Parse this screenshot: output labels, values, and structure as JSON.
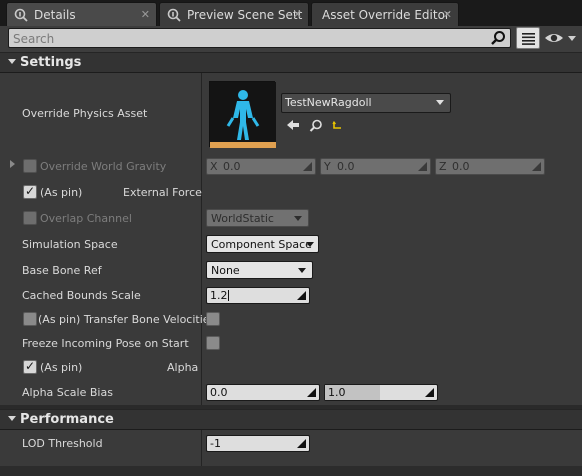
{
  "tabs": [
    {
      "label": "Details",
      "active": true
    },
    {
      "label": "Preview Scene Sett",
      "active": false
    },
    {
      "label": "Asset Override Editor",
      "active": false
    }
  ],
  "search": {
    "placeholder": "Search"
  },
  "categories": {
    "settings": "Settings",
    "performance": "Performance"
  },
  "settings": {
    "override_physics_asset": {
      "label": "Override Physics Asset",
      "value": "TestNewRagdoll"
    },
    "override_world_gravity": {
      "label": "Override World Gravity",
      "x_prefix": "X",
      "x": "0.0",
      "y_prefix": "Y",
      "y": "0.0",
      "z_prefix": "Z",
      "z": "0.0"
    },
    "external_force": {
      "pin_label": "(As pin)",
      "label": "External Force"
    },
    "overlap_channel": {
      "label": "Overlap Channel",
      "value": "WorldStatic"
    },
    "simulation_space": {
      "label": "Simulation Space",
      "value": "Component Space"
    },
    "base_bone_ref": {
      "label": "Base Bone Ref",
      "value": "None"
    },
    "cached_bounds_scale": {
      "label": "Cached Bounds Scale",
      "value": "1.2"
    },
    "transfer_bone_velocities": {
      "label": "(As pin) Transfer Bone Velocities"
    },
    "freeze_incoming_pose": {
      "label": "Freeze Incoming Pose on Start"
    },
    "alpha": {
      "pin_label": "(As pin)",
      "label": "Alpha"
    },
    "alpha_scale_bias": {
      "label": "Alpha Scale Bias",
      "min": "0.0",
      "max": "1.0"
    }
  },
  "performance": {
    "lod_threshold": {
      "label": "LOD Threshold",
      "value": "-1"
    }
  },
  "colors": {
    "accent": "#e8c400",
    "mannequin": "#2fb8e8"
  }
}
